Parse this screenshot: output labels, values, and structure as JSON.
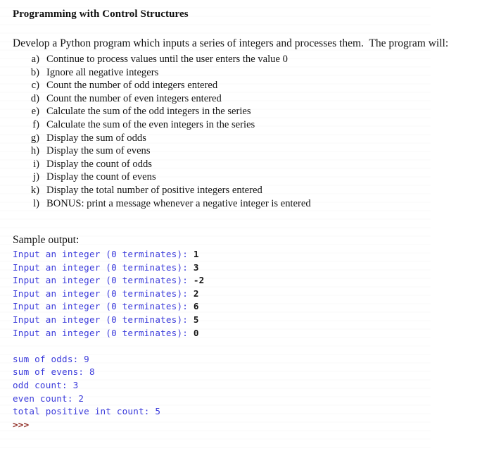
{
  "document": {
    "title": "Programming with Control Structures",
    "intro": "Develop a Python program which inputs a series of integers and processes them.  The program will:",
    "sample_output_label": "Sample output:"
  },
  "requirements": [
    {
      "marker": "a)",
      "text": "Continue to process values until the user enters the value 0"
    },
    {
      "marker": "b)",
      "text": "Ignore all negative integers"
    },
    {
      "marker": "c)",
      "text": "Count the number of odd integers entered"
    },
    {
      "marker": "d)",
      "text": "Count the number of even integers entered"
    },
    {
      "marker": "e)",
      "text": "Calculate the sum of the odd integers in the series"
    },
    {
      "marker": "f)",
      "text": "Calculate the sum of the even integers in the series"
    },
    {
      "marker": "g)",
      "text": "Display the sum of odds"
    },
    {
      "marker": "h)",
      "text": "Display the sum of evens"
    },
    {
      "marker": "i)",
      "text": "Display the count of odds"
    },
    {
      "marker": "j)",
      "text": "Display the count of evens"
    },
    {
      "marker": "k)",
      "text": "Display the total number of positive integers entered"
    },
    {
      "marker": "l)",
      "text": "BONUS: print a message whenever a negative integer is entered"
    }
  ],
  "console": {
    "prompt_text": "Input an integer (0 terminates): ",
    "shell_prompt": ">>>",
    "inputs": [
      {
        "prompt": "Input an integer (0 terminates): ",
        "value": "1"
      },
      {
        "prompt": "Input an integer (0 terminates): ",
        "value": "3"
      },
      {
        "prompt": "Input an integer (0 terminates): ",
        "value": "-2"
      },
      {
        "prompt": "Input an integer (0 terminates): ",
        "value": "2"
      },
      {
        "prompt": "Input an integer (0 terminates): ",
        "value": "6"
      },
      {
        "prompt": "Input an integer (0 terminates): ",
        "value": "5"
      },
      {
        "prompt": "Input an integer (0 terminates): ",
        "value": "0"
      }
    ],
    "results": [
      "sum of odds: 9",
      "sum of evens: 8",
      "odd count: 3",
      "even count: 2",
      "total positive int count: 5"
    ]
  },
  "colors": {
    "page_background": "#ffffff",
    "body_text": "#141414",
    "console_blue": "#3b3bdb",
    "console_entered_value": "#141414",
    "shell_prompt_red": "#8f2b23"
  }
}
